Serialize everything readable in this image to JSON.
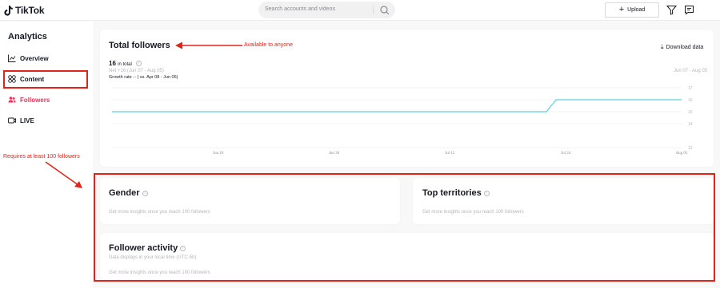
{
  "app": {
    "name": "TikTok"
  },
  "header": {
    "search_placeholder": "Search accounts and videos",
    "upload_label": "Upload"
  },
  "sidebar": {
    "title": "Analytics",
    "items": [
      {
        "label": "Overview",
        "icon": "chart-line-icon"
      },
      {
        "label": "Content",
        "icon": "grid-icon"
      },
      {
        "label": "Followers",
        "icon": "people-icon",
        "active": true
      },
      {
        "label": "LIVE",
        "icon": "live-icon"
      }
    ]
  },
  "total_followers": {
    "title": "Total followers",
    "count": "16",
    "count_suffix": "in total",
    "net": "Net +16 (Jun 07 - Aug 05)",
    "growth": "Growth rate -- ( vs. Apr 08 - Jun 06)",
    "date_range": "Jun 07 - Aug 05",
    "download_label": "Download data"
  },
  "chart_data": {
    "type": "line",
    "x": [
      "Jun 07",
      "Jun 18",
      "Jun 30",
      "Jul 12",
      "Jul 24",
      "Aug 05"
    ],
    "x_ticks": [
      "Jun 18",
      "Jun 30",
      "Jul 12",
      "Jul 24",
      "Aug 05"
    ],
    "yticks": [
      12,
      14,
      15,
      16,
      17
    ],
    "ylim": [
      12,
      17
    ],
    "series": [
      {
        "points": [
          [
            "Jun 07",
            15
          ],
          [
            "Jul 12",
            15
          ],
          [
            "Jul 22",
            15
          ],
          [
            "Jul 23",
            16
          ],
          [
            "Aug 05",
            16
          ]
        ],
        "color": "#5fd0e0"
      }
    ],
    "baseline_dashed": {
      "from": "Jun 07",
      "to": "Jul 12",
      "value": 15
    },
    "grid": true
  },
  "gender": {
    "title": "Gender",
    "note": "Get more insights once you reach 100 followers"
  },
  "territories": {
    "title": "Top territories",
    "note": "Get more insights once you reach 100 followers"
  },
  "activity": {
    "title": "Follower activity",
    "subtitle": "Data displays in your local time (UTC-5h)",
    "note": "Get more insights once you reach 100 followers"
  },
  "annotations": {
    "available": "Available to anyone",
    "requires": "Requires at least 100 followers",
    "color": "#e2231a"
  }
}
